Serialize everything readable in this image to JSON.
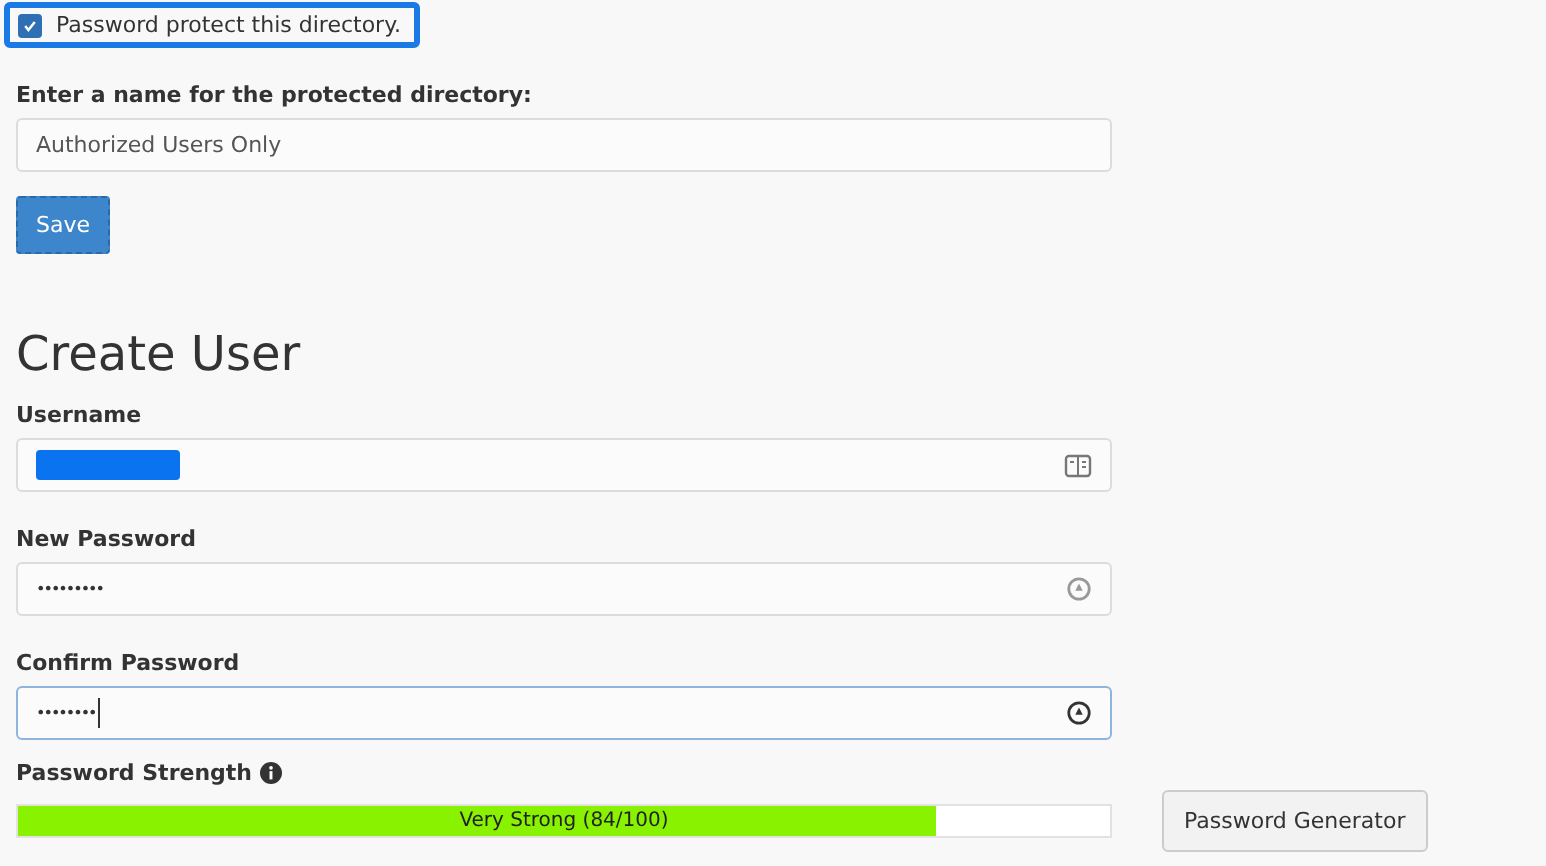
{
  "protect": {
    "label": "Password protect this directory.",
    "checked": true
  },
  "directory": {
    "label": "Enter a name for the protected directory:",
    "value": "Authorized Users Only"
  },
  "save_button": "Save",
  "create_user": {
    "title": "Create User",
    "fields": [
      {
        "label": "Username",
        "kind": "redacted",
        "focused": false
      },
      {
        "label": "New Password",
        "kind": "password",
        "value": "•••••••••",
        "focused": false
      },
      {
        "label": "Confirm Password",
        "kind": "password",
        "value": "••••••••",
        "focused": true
      }
    ],
    "strength": {
      "label": "Password Strength",
      "level": 0.84,
      "reading": "Very Strong (84/100)"
    },
    "generator_button": "Password Generator"
  }
}
